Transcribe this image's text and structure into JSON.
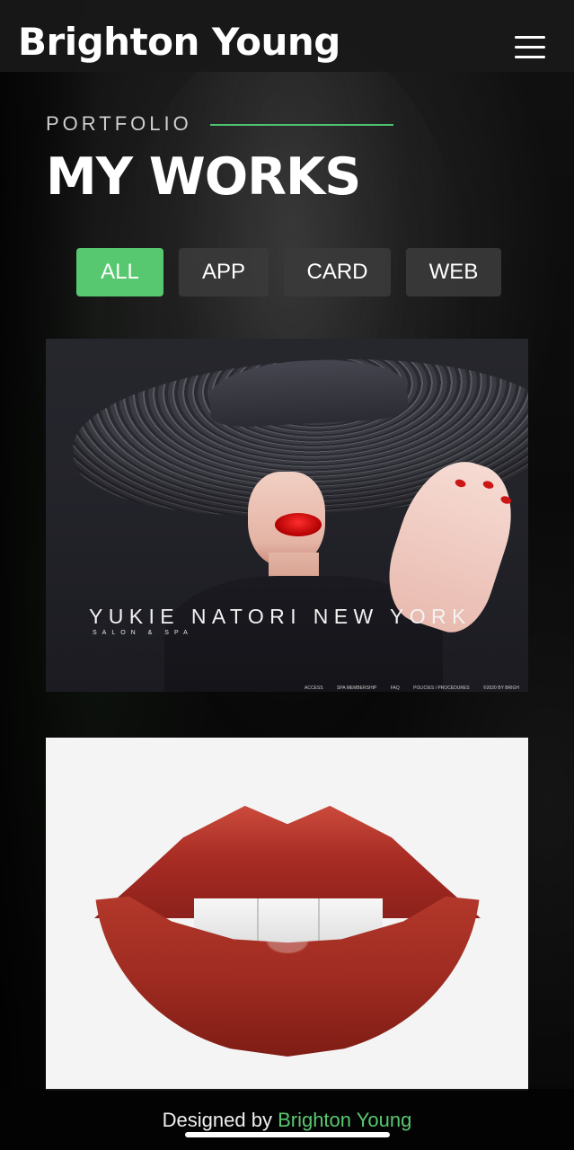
{
  "header": {
    "brand": "Brighton Young",
    "menu_icon": "menu-icon"
  },
  "section": {
    "eyebrow": "PORTFOLIO",
    "title": "MY WORKS",
    "accent_color": "#58c870"
  },
  "filters": [
    {
      "label": "ALL",
      "active": true
    },
    {
      "label": "APP",
      "active": false
    },
    {
      "label": "CARD",
      "active": false
    },
    {
      "label": "WEB",
      "active": false
    }
  ],
  "works": [
    {
      "type": "image",
      "title": "YUKIE NATORI NEW YORK",
      "subtitle": "SALON & SPA",
      "footer_links": [
        "ACCESS",
        "SPA MEMBERSHIP",
        "FAQ",
        "POLICIES / PROCEDURES",
        "©2020 BY BRIGH"
      ]
    },
    {
      "type": "image"
    }
  ],
  "footer": {
    "prefix": "Designed by ",
    "author": "Brighton Young"
  }
}
